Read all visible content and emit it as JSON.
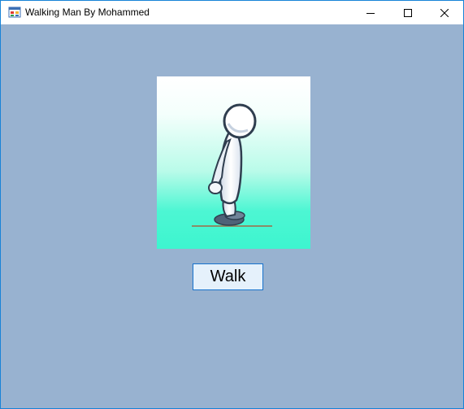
{
  "window": {
    "title": "Walking Man By Mohammed",
    "icon": "windows-form-icon",
    "controls": {
      "minimize_icon": "minimize-icon",
      "maximize_icon": "maximize-icon",
      "close_icon": "close-icon"
    },
    "background_color": "#98b2d0",
    "border_color": "#1883d7"
  },
  "main": {
    "picture": {
      "icon": "walking-stick-figure-image",
      "gradient_top": "#ffffff",
      "gradient_bottom": "#3df5cf"
    },
    "walk_button": {
      "label": "Walk",
      "background_color": "#e5f1fb",
      "border_color": "#1672cc"
    }
  }
}
